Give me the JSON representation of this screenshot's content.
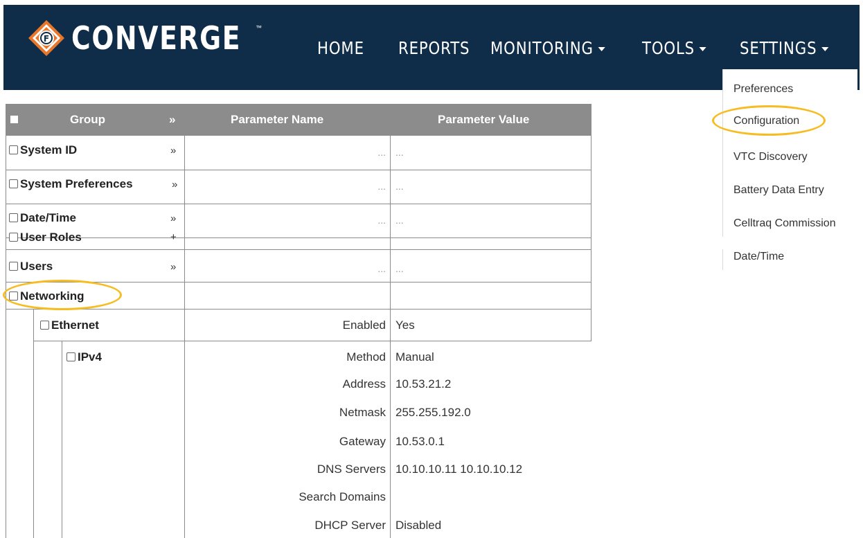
{
  "nav": {
    "logo_text": "CONVERGE",
    "logo_tm": "™",
    "items": [
      {
        "label": "HOME",
        "has_caret": false
      },
      {
        "label": "REPORTS",
        "has_caret": false
      },
      {
        "label": "MONITORING",
        "has_caret": true
      },
      {
        "label": "TOOLS",
        "has_caret": true
      },
      {
        "label": "SETTINGS",
        "has_caret": true
      }
    ]
  },
  "settings_menu": {
    "items": [
      "Preferences",
      "Configuration",
      "VTC Discovery",
      "Battery Data Entry",
      "Celltraq Commission",
      "Date/Time"
    ],
    "highlighted": "Configuration"
  },
  "table": {
    "headers": {
      "group": "Group",
      "group_expander": "»",
      "name": "Parameter Name",
      "value": "Parameter Value"
    },
    "rows": [
      {
        "group": "System ID",
        "expander": "»",
        "name": "...",
        "value": "..."
      },
      {
        "group": "System Preferences",
        "expander": "»",
        "name": "...",
        "value": "..."
      },
      {
        "group": "Date/Time",
        "expander": "»",
        "name": "...",
        "value": "..."
      },
      {
        "group": "User Roles",
        "expander": "+",
        "name": "",
        "value": ""
      },
      {
        "group": "Users",
        "expander": "»",
        "name": "...",
        "value": "..."
      },
      {
        "group": "Networking",
        "expander": "",
        "name": "",
        "value": ""
      }
    ],
    "ethernet": {
      "group": "Ethernet",
      "name": "Enabled",
      "value": "Yes"
    },
    "ipv4": {
      "group": "IPv4",
      "params": [
        {
          "name": "Method",
          "value": "Manual"
        },
        {
          "name": "Address",
          "value": "10.53.21.2"
        },
        {
          "name": "Netmask",
          "value": "255.255.192.0"
        },
        {
          "name": "Gateway",
          "value": "10.53.0.1"
        },
        {
          "name": "DNS Servers",
          "value": "10.10.10.11 10.10.10.12"
        },
        {
          "name": "Search Domains",
          "value": ""
        },
        {
          "name": "DHCP Server",
          "value": "Disabled"
        }
      ]
    },
    "highlighted_group": "Networking"
  },
  "colors": {
    "navbar": "#0f2d48",
    "table_header": "#8c8c8c",
    "highlight": "#f6bc22"
  }
}
